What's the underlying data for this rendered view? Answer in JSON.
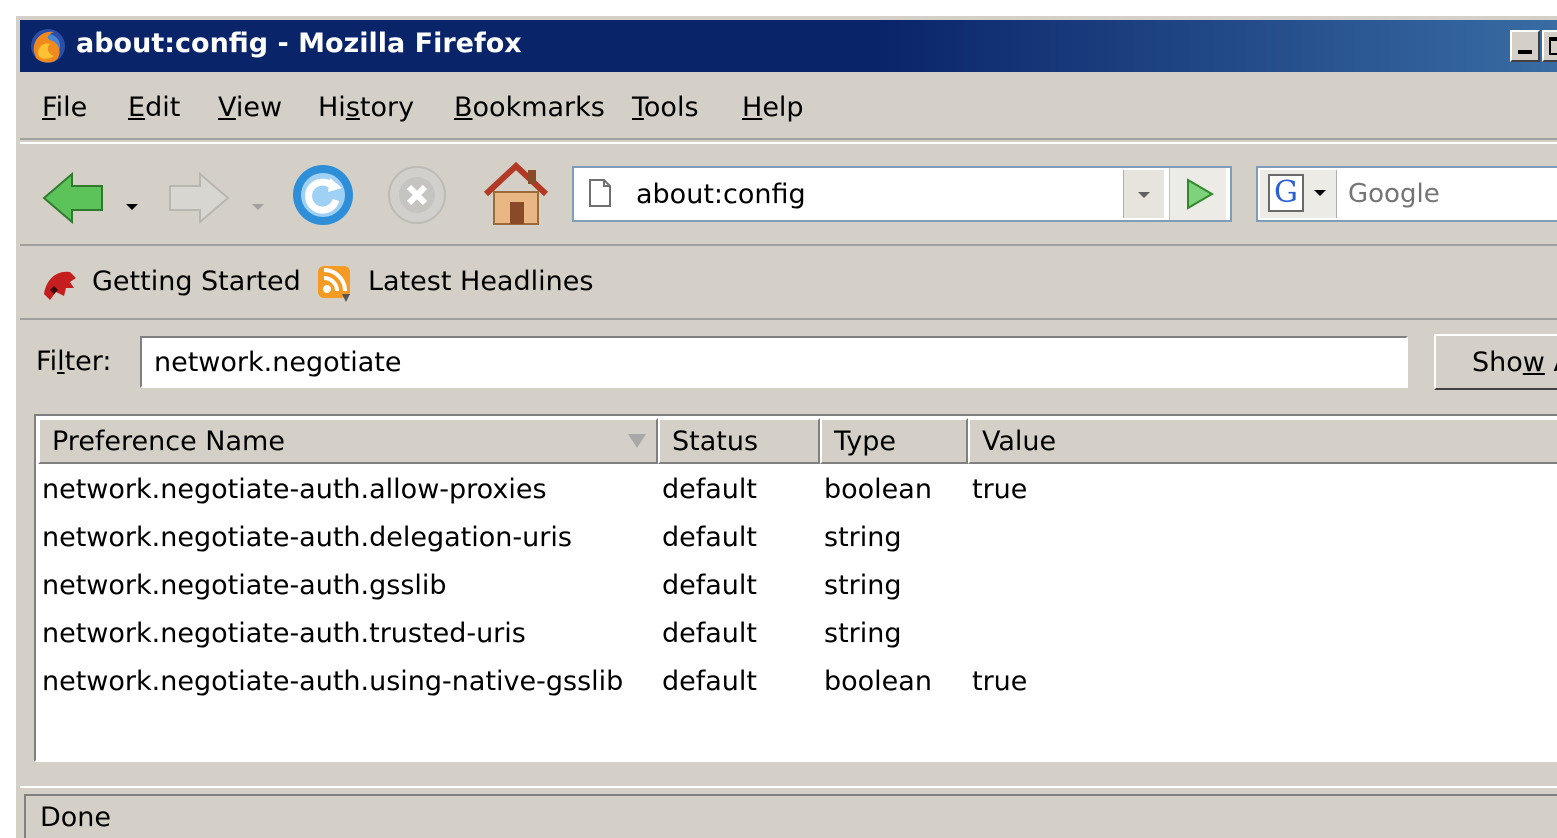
{
  "window": {
    "title": "about:config - Mozilla Firefox"
  },
  "menu": {
    "items": [
      {
        "label": "File",
        "mnemonic_index": 0
      },
      {
        "label": "Edit",
        "mnemonic_index": 0
      },
      {
        "label": "View",
        "mnemonic_index": 0
      },
      {
        "label": "History",
        "mnemonic_index": 2
      },
      {
        "label": "Bookmarks",
        "mnemonic_index": 0
      },
      {
        "label": "Tools",
        "mnemonic_index": 0
      },
      {
        "label": "Help",
        "mnemonic_index": 0
      }
    ]
  },
  "navigation": {
    "url": "about:config",
    "search_placeholder": "Google",
    "search_engine_letter": "G"
  },
  "bookmarks": {
    "items": [
      {
        "label": "Getting Started",
        "icon": "firefox-dino-icon"
      },
      {
        "label": "Latest Headlines",
        "icon": "rss-feed-icon"
      }
    ]
  },
  "filter": {
    "label": "Filter:",
    "value": "network.negotiate",
    "show_all_label": "Show A"
  },
  "table": {
    "columns": [
      "Preference Name",
      "Status",
      "Type",
      "Value"
    ],
    "rows": [
      {
        "name": "network.negotiate-auth.allow-proxies",
        "status": "default",
        "type": "boolean",
        "value": "true"
      },
      {
        "name": "network.negotiate-auth.delegation-uris",
        "status": "default",
        "type": "string",
        "value": ""
      },
      {
        "name": "network.negotiate-auth.gsslib",
        "status": "default",
        "type": "string",
        "value": ""
      },
      {
        "name": "network.negotiate-auth.trusted-uris",
        "status": "default",
        "type": "string",
        "value": ""
      },
      {
        "name": "network.negotiate-auth.using-native-gsslib",
        "status": "default",
        "type": "boolean",
        "value": "true"
      }
    ]
  },
  "status": {
    "text": "Done"
  },
  "colors": {
    "titlebar": "#0a246a",
    "chrome": "#d4d0c8",
    "go_arrow": "#46a842",
    "back_arrow": "#5cc25a",
    "reload": "#2e8fd8"
  }
}
